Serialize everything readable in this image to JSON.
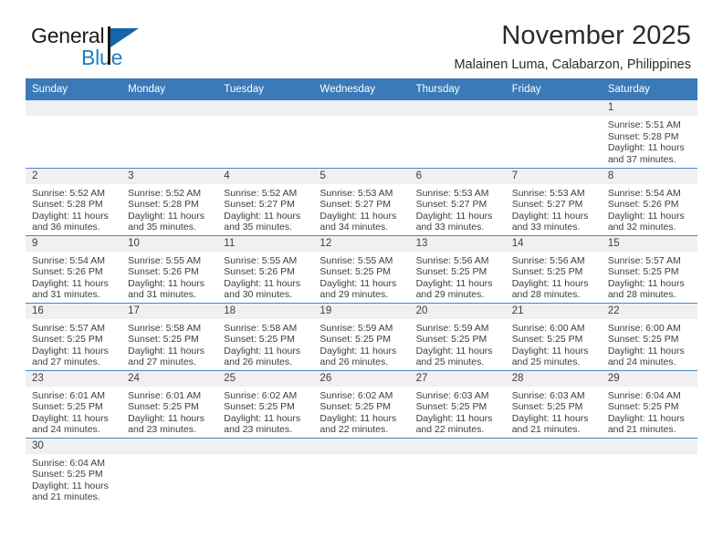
{
  "brand": {
    "name_part1": "General",
    "name_part2": "Blue",
    "triangle_color": "#1565a8",
    "blue_text_color": "#1f7ec4"
  },
  "header": {
    "title": "November 2025",
    "subtitle": "Malainen Luma, Calabarzon, Philippines"
  },
  "theme": {
    "header_blue": "#3a7ab8",
    "row_divider_blue": "#4a86c4",
    "daynum_strip_gray": "#f0f0f0",
    "text_color": "#3d3d3d"
  },
  "weekday_headers": [
    "Sunday",
    "Monday",
    "Tuesday",
    "Wednesday",
    "Thursday",
    "Friday",
    "Saturday"
  ],
  "weeks": [
    [
      {
        "day": "",
        "empty": true
      },
      {
        "day": "",
        "empty": true
      },
      {
        "day": "",
        "empty": true
      },
      {
        "day": "",
        "empty": true
      },
      {
        "day": "",
        "empty": true
      },
      {
        "day": "",
        "empty": true
      },
      {
        "day": "1",
        "sunrise": "Sunrise: 5:51 AM",
        "sunset": "Sunset: 5:28 PM",
        "daylight_line1": "Daylight: 11 hours",
        "daylight_line2": "and 37 minutes."
      }
    ],
    [
      {
        "day": "2",
        "sunrise": "Sunrise: 5:52 AM",
        "sunset": "Sunset: 5:28 PM",
        "daylight_line1": "Daylight: 11 hours",
        "daylight_line2": "and 36 minutes."
      },
      {
        "day": "3",
        "sunrise": "Sunrise: 5:52 AM",
        "sunset": "Sunset: 5:28 PM",
        "daylight_line1": "Daylight: 11 hours",
        "daylight_line2": "and 35 minutes."
      },
      {
        "day": "4",
        "sunrise": "Sunrise: 5:52 AM",
        "sunset": "Sunset: 5:27 PM",
        "daylight_line1": "Daylight: 11 hours",
        "daylight_line2": "and 35 minutes."
      },
      {
        "day": "5",
        "sunrise": "Sunrise: 5:53 AM",
        "sunset": "Sunset: 5:27 PM",
        "daylight_line1": "Daylight: 11 hours",
        "daylight_line2": "and 34 minutes."
      },
      {
        "day": "6",
        "sunrise": "Sunrise: 5:53 AM",
        "sunset": "Sunset: 5:27 PM",
        "daylight_line1": "Daylight: 11 hours",
        "daylight_line2": "and 33 minutes."
      },
      {
        "day": "7",
        "sunrise": "Sunrise: 5:53 AM",
        "sunset": "Sunset: 5:27 PM",
        "daylight_line1": "Daylight: 11 hours",
        "daylight_line2": "and 33 minutes."
      },
      {
        "day": "8",
        "sunrise": "Sunrise: 5:54 AM",
        "sunset": "Sunset: 5:26 PM",
        "daylight_line1": "Daylight: 11 hours",
        "daylight_line2": "and 32 minutes."
      }
    ],
    [
      {
        "day": "9",
        "sunrise": "Sunrise: 5:54 AM",
        "sunset": "Sunset: 5:26 PM",
        "daylight_line1": "Daylight: 11 hours",
        "daylight_line2": "and 31 minutes."
      },
      {
        "day": "10",
        "sunrise": "Sunrise: 5:55 AM",
        "sunset": "Sunset: 5:26 PM",
        "daylight_line1": "Daylight: 11 hours",
        "daylight_line2": "and 31 minutes."
      },
      {
        "day": "11",
        "sunrise": "Sunrise: 5:55 AM",
        "sunset": "Sunset: 5:26 PM",
        "daylight_line1": "Daylight: 11 hours",
        "daylight_line2": "and 30 minutes."
      },
      {
        "day": "12",
        "sunrise": "Sunrise: 5:55 AM",
        "sunset": "Sunset: 5:25 PM",
        "daylight_line1": "Daylight: 11 hours",
        "daylight_line2": "and 29 minutes."
      },
      {
        "day": "13",
        "sunrise": "Sunrise: 5:56 AM",
        "sunset": "Sunset: 5:25 PM",
        "daylight_line1": "Daylight: 11 hours",
        "daylight_line2": "and 29 minutes."
      },
      {
        "day": "14",
        "sunrise": "Sunrise: 5:56 AM",
        "sunset": "Sunset: 5:25 PM",
        "daylight_line1": "Daylight: 11 hours",
        "daylight_line2": "and 28 minutes."
      },
      {
        "day": "15",
        "sunrise": "Sunrise: 5:57 AM",
        "sunset": "Sunset: 5:25 PM",
        "daylight_line1": "Daylight: 11 hours",
        "daylight_line2": "and 28 minutes."
      }
    ],
    [
      {
        "day": "16",
        "sunrise": "Sunrise: 5:57 AM",
        "sunset": "Sunset: 5:25 PM",
        "daylight_line1": "Daylight: 11 hours",
        "daylight_line2": "and 27 minutes."
      },
      {
        "day": "17",
        "sunrise": "Sunrise: 5:58 AM",
        "sunset": "Sunset: 5:25 PM",
        "daylight_line1": "Daylight: 11 hours",
        "daylight_line2": "and 27 minutes."
      },
      {
        "day": "18",
        "sunrise": "Sunrise: 5:58 AM",
        "sunset": "Sunset: 5:25 PM",
        "daylight_line1": "Daylight: 11 hours",
        "daylight_line2": "and 26 minutes."
      },
      {
        "day": "19",
        "sunrise": "Sunrise: 5:59 AM",
        "sunset": "Sunset: 5:25 PM",
        "daylight_line1": "Daylight: 11 hours",
        "daylight_line2": "and 26 minutes."
      },
      {
        "day": "20",
        "sunrise": "Sunrise: 5:59 AM",
        "sunset": "Sunset: 5:25 PM",
        "daylight_line1": "Daylight: 11 hours",
        "daylight_line2": "and 25 minutes."
      },
      {
        "day": "21",
        "sunrise": "Sunrise: 6:00 AM",
        "sunset": "Sunset: 5:25 PM",
        "daylight_line1": "Daylight: 11 hours",
        "daylight_line2": "and 25 minutes."
      },
      {
        "day": "22",
        "sunrise": "Sunrise: 6:00 AM",
        "sunset": "Sunset: 5:25 PM",
        "daylight_line1": "Daylight: 11 hours",
        "daylight_line2": "and 24 minutes."
      }
    ],
    [
      {
        "day": "23",
        "sunrise": "Sunrise: 6:01 AM",
        "sunset": "Sunset: 5:25 PM",
        "daylight_line1": "Daylight: 11 hours",
        "daylight_line2": "and 24 minutes."
      },
      {
        "day": "24",
        "sunrise": "Sunrise: 6:01 AM",
        "sunset": "Sunset: 5:25 PM",
        "daylight_line1": "Daylight: 11 hours",
        "daylight_line2": "and 23 minutes."
      },
      {
        "day": "25",
        "sunrise": "Sunrise: 6:02 AM",
        "sunset": "Sunset: 5:25 PM",
        "daylight_line1": "Daylight: 11 hours",
        "daylight_line2": "and 23 minutes."
      },
      {
        "day": "26",
        "sunrise": "Sunrise: 6:02 AM",
        "sunset": "Sunset: 5:25 PM",
        "daylight_line1": "Daylight: 11 hours",
        "daylight_line2": "and 22 minutes."
      },
      {
        "day": "27",
        "sunrise": "Sunrise: 6:03 AM",
        "sunset": "Sunset: 5:25 PM",
        "daylight_line1": "Daylight: 11 hours",
        "daylight_line2": "and 22 minutes."
      },
      {
        "day": "28",
        "sunrise": "Sunrise: 6:03 AM",
        "sunset": "Sunset: 5:25 PM",
        "daylight_line1": "Daylight: 11 hours",
        "daylight_line2": "and 21 minutes."
      },
      {
        "day": "29",
        "sunrise": "Sunrise: 6:04 AM",
        "sunset": "Sunset: 5:25 PM",
        "daylight_line1": "Daylight: 11 hours",
        "daylight_line2": "and 21 minutes."
      }
    ],
    [
      {
        "day": "30",
        "sunrise": "Sunrise: 6:04 AM",
        "sunset": "Sunset: 5:25 PM",
        "daylight_line1": "Daylight: 11 hours",
        "daylight_line2": "and 21 minutes."
      },
      {
        "day": "",
        "empty": true
      },
      {
        "day": "",
        "empty": true
      },
      {
        "day": "",
        "empty": true
      },
      {
        "day": "",
        "empty": true
      },
      {
        "day": "",
        "empty": true
      },
      {
        "day": "",
        "empty": true
      }
    ]
  ]
}
